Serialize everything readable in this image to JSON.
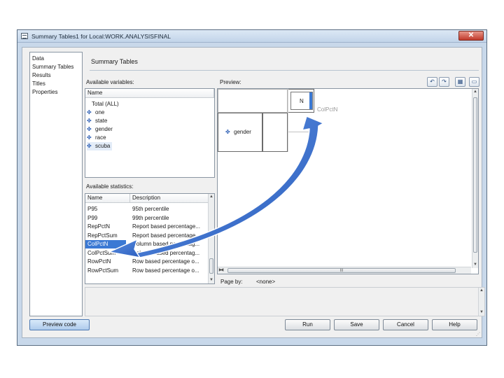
{
  "window": {
    "title": "Summary Tables1 for Local:WORK.ANALYSISFINAL",
    "close_label": "✕"
  },
  "nav": {
    "items": [
      "Data",
      "Summary Tables",
      "Results",
      "Titles",
      "Properties"
    ]
  },
  "main": {
    "section_title": "Summary Tables",
    "available_variables_label": "Available variables:",
    "variables": {
      "column": "Name",
      "items": [
        "Total (ALL)",
        "one",
        "state",
        "gender",
        "race",
        "scuba"
      ]
    },
    "available_statistics_label": "Available statistics:",
    "statistics": {
      "columns": [
        "Name",
        "Description"
      ],
      "rows": [
        [
          "P95",
          "95th percentile"
        ],
        [
          "P99",
          "99th percentile"
        ],
        [
          "RepPctN",
          "Report based percentage..."
        ],
        [
          "RepPctSum",
          "Report based percentage..."
        ],
        [
          "ColPctN",
          "Column based percentag..."
        ],
        [
          "ColPctSum",
          "Column based percentag..."
        ],
        [
          "RowPctN",
          "Row based percentage o..."
        ],
        [
          "RowPctSum",
          "Row based percentage o..."
        ]
      ],
      "selected_index": 4
    },
    "preview_label": "Preview:",
    "preview": {
      "n_cell": "N",
      "colpct_label": "ColPctN",
      "row_var": "gender"
    },
    "scroll_mid": "III",
    "page_by_label": "Page by:",
    "page_by_value": "<none>"
  },
  "footer": {
    "preview_code": "Preview code",
    "run": "Run",
    "save": "Save",
    "cancel": "Cancel",
    "help": "Help"
  },
  "colors": {
    "selection": "#3b79d4",
    "arrow": "#2f66c4",
    "window_frame": "#c8d8ea"
  }
}
